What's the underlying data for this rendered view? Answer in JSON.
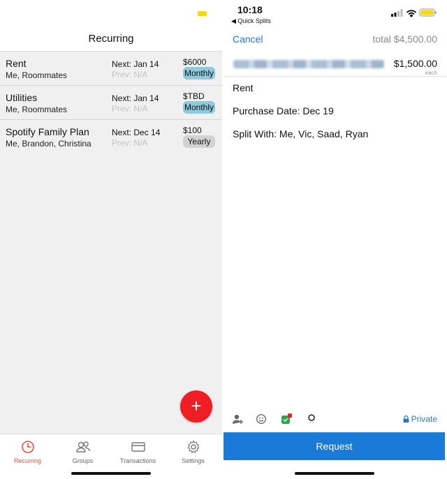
{
  "left": {
    "header_title": "Recurring",
    "items": [
      {
        "name": "Rent",
        "people": "Me, Roommates",
        "next": "Next: Jan 14",
        "prev": "Prev: N/A",
        "amount": "$6000",
        "frequency": "Monthly"
      },
      {
        "name": "Utilities",
        "people": "Me, Roommates",
        "next": "Next: Jan 14",
        "prev": "Prev: N/A",
        "amount": "$TBD",
        "frequency": "Monthly"
      },
      {
        "name": "Spotify Family Plan",
        "people": "Me, Brandon, Christina",
        "next": "Next: Dec 14",
        "prev": "Prev: N/A",
        "amount": "$100",
        "frequency": "Yearly"
      }
    ],
    "fab_label": "+",
    "tabs": [
      {
        "label": "Recurring",
        "icon": "clock-icon",
        "active": true
      },
      {
        "label": "Groups",
        "icon": "people-icon",
        "active": false
      },
      {
        "label": "Transactions",
        "icon": "card-icon",
        "active": false
      },
      {
        "label": "Settings",
        "icon": "gear-icon",
        "active": false
      }
    ],
    "colors": {
      "accent": "#e94e3c",
      "monthly_badge": "#8ec9dd",
      "yearly_badge": "#d2d2d2",
      "fab": "#ef1d24"
    }
  },
  "right": {
    "status": {
      "time": "10:18",
      "back_label": "◀ Quick Splits"
    },
    "cancel_label": "Cancel",
    "total_label": "total $4,500.00",
    "each_amount": "$1,500.00",
    "each_label": "each",
    "description": "Rent",
    "purchase_date": "Purchase Date: Dec 19",
    "split_with": "Split With: Me, Vic, Saad, Ryan",
    "privacy_label": "Private",
    "request_label": "Request",
    "colors": {
      "link": "#2a78c9",
      "request_button": "#1a7ad8"
    }
  }
}
